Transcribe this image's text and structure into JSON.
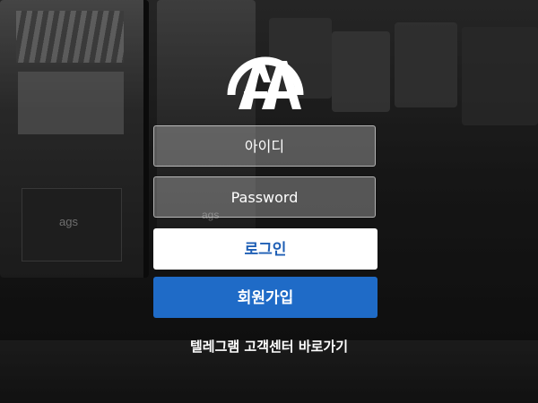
{
  "logo": {
    "text": "AA",
    "icon": "aa-logo-icon",
    "color": "#ffffff"
  },
  "form": {
    "id_placeholder": "아이디",
    "password_placeholder": "Password"
  },
  "buttons": {
    "login_label": "로그인",
    "signup_label": "회원가입"
  },
  "links": {
    "telegram_label": "텔레그램 고객센터 바로가기"
  },
  "background": {
    "machine_logo_1": "ags",
    "machine_logo_2": "ags"
  },
  "colors": {
    "accent": "#1f6bc7",
    "login_text": "#1f5fb5",
    "text": "#ffffff"
  }
}
